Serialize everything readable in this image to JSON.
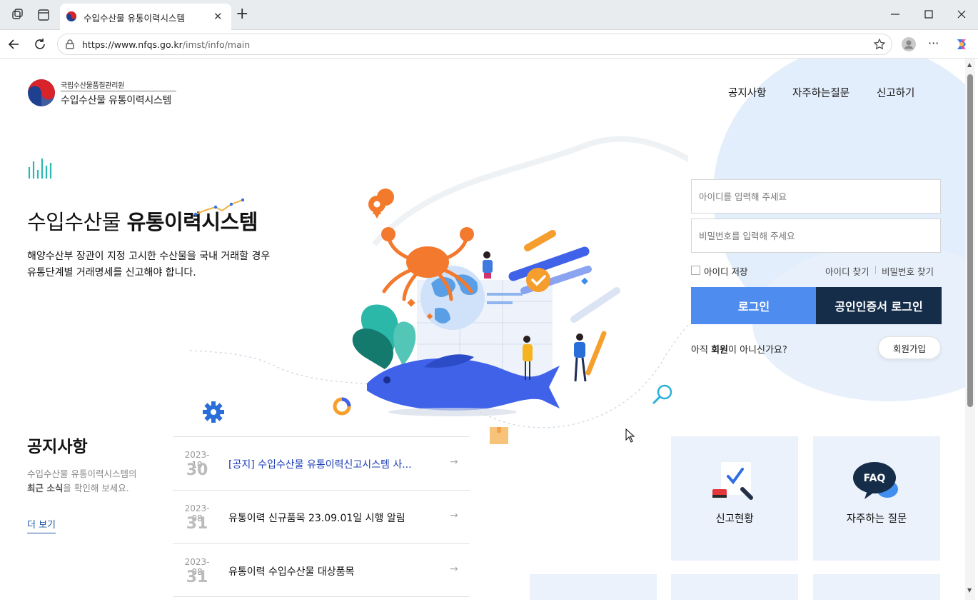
{
  "browser": {
    "tab_title": "수입수산물 유통이력시스템",
    "url_host": "https://www.nfqs.go.kr",
    "url_path": "/imst/info/main"
  },
  "header": {
    "org_small": "국립수산물품질관리원",
    "org_name": "수입수산물 유통이력시스템",
    "nav": [
      "공지사항",
      "자주하는질문",
      "신고하기"
    ]
  },
  "hero": {
    "title_light": "수입수산물 ",
    "title_bold": "유통이력시스템",
    "desc_line1": "해양수산부 장관이 지정 고시한 수산물을 국내 거래할 경우",
    "desc_line2": "유통단계별 거래명세를 신고해야 합니다."
  },
  "login": {
    "id_placeholder": "아이디를 입력해 주세요",
    "pw_placeholder": "비밀번호를 입력해 주세요",
    "save_id": "아이디 저장",
    "find_id": "아이디 찾기",
    "find_pw": "비밀번호 찾기",
    "login_btn": "로그인",
    "cert_btn": "공인인증서 로그인",
    "join_prefix": "아직 ",
    "join_bold": "회원",
    "join_suffix": "이 아니신가요?",
    "join_btn": "회원가입"
  },
  "notices": {
    "title": "공지사항",
    "desc_line1": "수입수산물 유통이력시스템의",
    "desc_bold": "최근 소식",
    "desc_line2": "을 확인해 보세요.",
    "more": "더 보기",
    "items": [
      {
        "date": "2023-10",
        "day": "30",
        "title": "[공지] 수입수산물 유통이력신고시스템 사..."
      },
      {
        "date": "2023-08",
        "day": "31",
        "title": "유통이력 신규품목 23.09.01일 시행 알림"
      },
      {
        "date": "2023-08",
        "day": "31",
        "title": "유통이력 수입수산물 대상품목"
      }
    ]
  },
  "tiles": [
    {
      "label": "신고현황",
      "icon": "report-icon"
    },
    {
      "label": "자주하는 질문",
      "icon": "faq-icon",
      "icon_text": "FAQ"
    }
  ],
  "colors": {
    "primary_blue": "#4f8cf0",
    "navy": "#152d49",
    "tile_bg": "#ebf2fb",
    "notice_highlight": "#1a3bb5"
  }
}
